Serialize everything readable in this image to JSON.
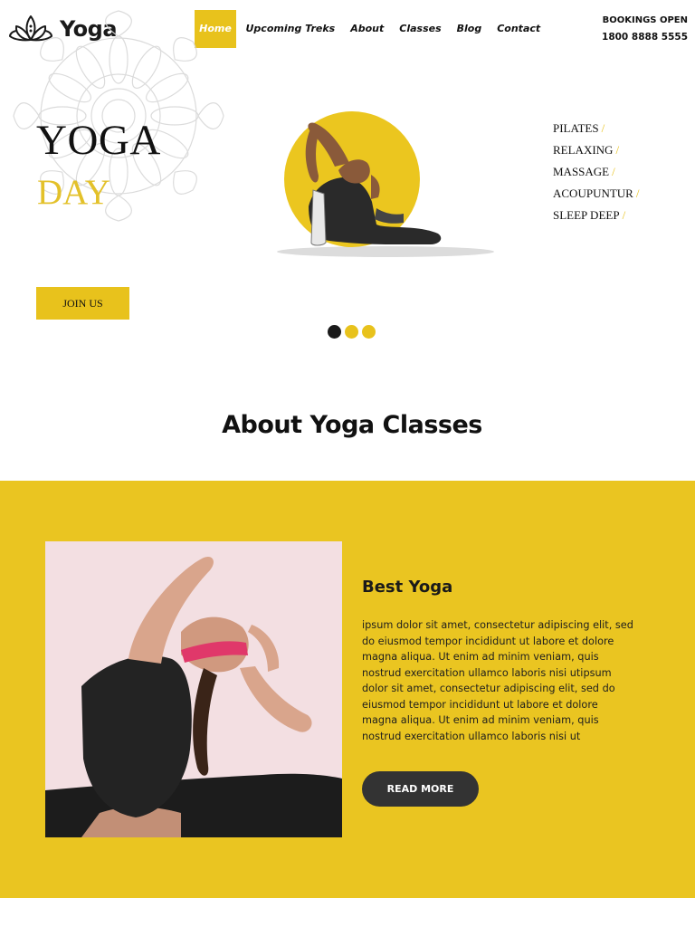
{
  "brand": {
    "name": "Yoga",
    "logo_icon": "lotus-icon"
  },
  "nav": {
    "items": [
      {
        "label": "Home",
        "active": true
      },
      {
        "label": "Upcoming Treks",
        "active": false
      },
      {
        "label": "About",
        "active": false
      },
      {
        "label": "Classes",
        "active": false
      },
      {
        "label": "Blog",
        "active": false
      },
      {
        "label": "Contact",
        "active": false
      }
    ]
  },
  "bookings": {
    "label": "BOOKINGS OPEN",
    "phone": "1800 8888 5555"
  },
  "hero": {
    "title": "YOGA",
    "subtitle": "DAY",
    "offerings": [
      "PILATES",
      "RELAXING",
      "MASSAGE",
      "ACOUPUNTUR",
      "SLEEP DEEP"
    ],
    "offering_separator": "/",
    "join_button": "JOIN US",
    "slides": {
      "count": 3,
      "active_index": 0
    }
  },
  "about": {
    "section_title": "About Yoga Classes",
    "card_title": "Best Yoga",
    "card_body": "ipsum dolor sit amet, consectetur adipiscing elit, sed do eiusmod tempor incididunt ut labore et dolore magna aliqua. Ut enim ad minim veniam, quis nostrud exercitation ullamco laboris nisi utipsum dolor sit amet, consectetur adipiscing elit, sed do eiusmod tempor incididunt ut labore et dolore magna aliqua. Ut enim ad minim veniam, quis nostrud exercitation ullamco laboris nisi ut",
    "read_more": "READ MORE"
  },
  "colors": {
    "accent": "#e8c21c",
    "band": "#eac521",
    "dark": "#333333",
    "text": "#111111"
  }
}
